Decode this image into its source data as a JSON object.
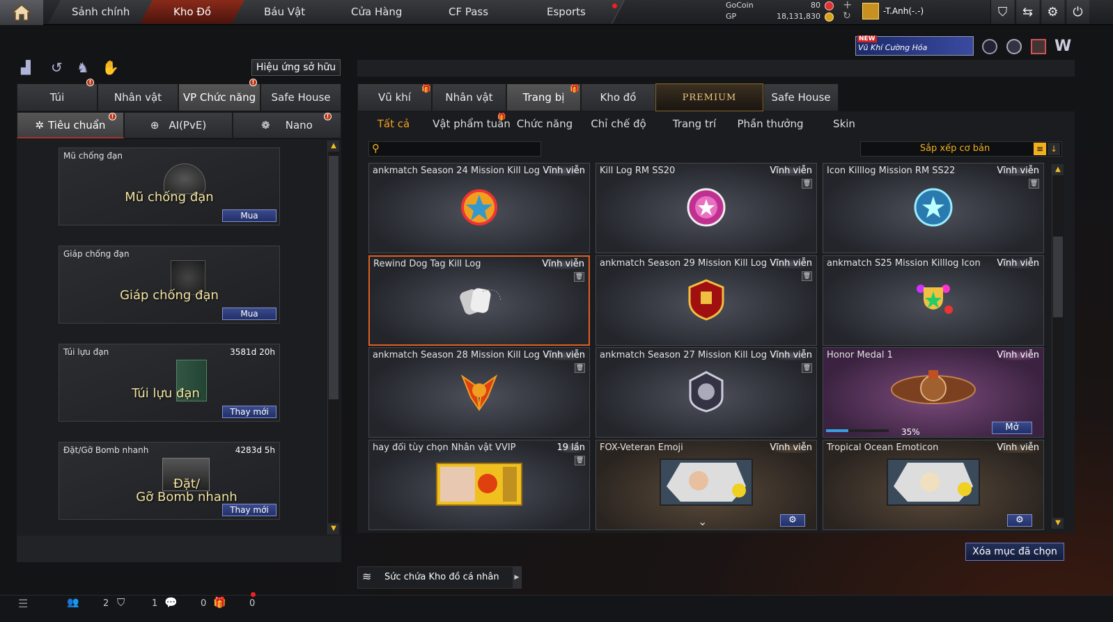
{
  "top_nav": {
    "tabs": [
      "Sảnh chính",
      "Kho Đồ",
      "Báu Vật",
      "Cửa Hàng",
      "CF Pass",
      "Esports"
    ],
    "gocoin_label": "GoCoin",
    "gocoin_value": "80",
    "gp_label": "GP",
    "gp_value": "18,131,830",
    "username": "-T.Anh(-.-)",
    "promo_new": "NEW",
    "promo_text": "Vũ Khí Cường Hóa"
  },
  "left": {
    "effects_button": "Hiệu ứng sở hữu",
    "tabs": [
      "Túi",
      "Nhân vật",
      "VP Chức năng",
      "Safe House"
    ],
    "subtabs": [
      "Tiêu chuẩn",
      "AI(PvE)",
      "Nano"
    ],
    "cards": [
      {
        "title": "Mũ chống đạn",
        "time": "",
        "big": "Mũ chống đạn",
        "button": "Mua"
      },
      {
        "title": "Giáp chống đạn",
        "time": "",
        "big": "Giáp chống đạn",
        "button": "Mua"
      },
      {
        "title": "Túi lựu đạn",
        "time": "3581d 20h",
        "big": "Túi lựu đạn",
        "button": "Thay mới"
      },
      {
        "title": "Đặt/Gỡ Bomb nhanh",
        "time": "4283d 5h",
        "big": "Đặt/\nGỡ Bomb nhanh",
        "button": "Thay mới"
      }
    ]
  },
  "right": {
    "tabs": [
      "Vũ khí",
      "Nhân vật",
      "Trang bị",
      "Kho đồ",
      "PREMIUM",
      "Safe House"
    ],
    "subtabs": [
      "Tất cả",
      "Vật phẩm tuần",
      "Chức năng",
      "Chỉ chế độ",
      "Trang trí",
      "Phần thưởng",
      "Skin"
    ],
    "search_placeholder": "",
    "sort_label": "Sắp xếp cơ bản",
    "items": [
      {
        "name": "ankmatch Season 24 Mission Kill Log",
        "duration": "Vĩnh viễn"
      },
      {
        "name": "Kill Log RM SS20",
        "duration": "Vĩnh viễn"
      },
      {
        "name": "Icon Killlog Mission RM SS22",
        "duration": "Vĩnh viễn"
      },
      {
        "name": "Rewind Dog Tag Kill Log",
        "duration": "Vĩnh viễn"
      },
      {
        "name": "ankmatch Season 29 Mission Kill Log",
        "duration": "Vĩnh viễn"
      },
      {
        "name": "ankmatch S25 Mission Killlog Icon",
        "duration": "Vĩnh viễn"
      },
      {
        "name": "ankmatch Season 28 Mission Kill Log",
        "duration": "Vĩnh viễn"
      },
      {
        "name": "ankmatch Season 27 Mission Kill Log",
        "duration": "Vĩnh viễn"
      },
      {
        "name": "Honor Medal 1",
        "duration": "Vĩnh viễn",
        "progress": "35%",
        "progress_value": 0.35,
        "button": "Mở"
      },
      {
        "name": "hay đổi tùy chọn Nhân vật VVIP",
        "duration": "19 lần"
      },
      {
        "name": "FOX-Veteran Emoji",
        "duration": "Vĩnh viễn"
      },
      {
        "name": "Tropical Ocean Emoticon",
        "duration": "Vĩnh viễn"
      }
    ],
    "delete_selected": "Xóa mục đã chọn",
    "capacity_label": "Sức chứa Kho đồ cá nhân"
  },
  "bottom": {
    "counts": [
      "2",
      "1",
      "0",
      "0"
    ]
  }
}
